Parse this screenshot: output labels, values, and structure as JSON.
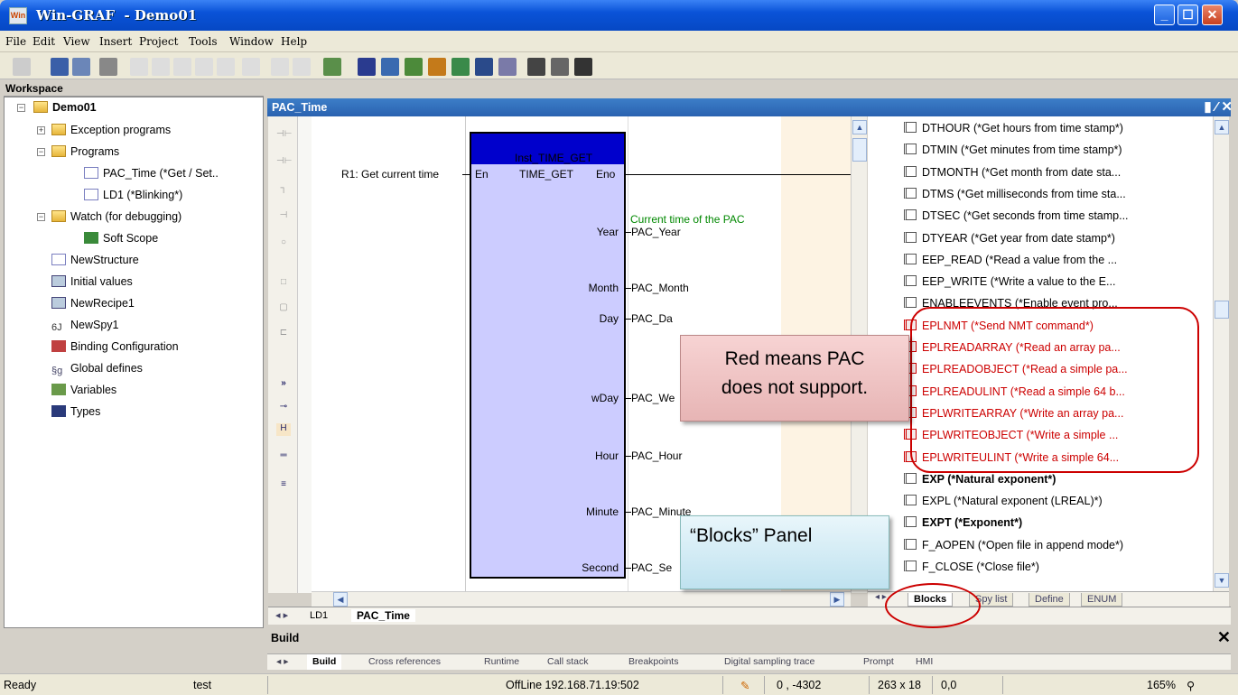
{
  "window": {
    "app": "Win-GRAF",
    "doc": "- Demo01",
    "icon_text": "Win"
  },
  "menu": [
    "File",
    "Edit",
    "View",
    "Insert",
    "Project",
    "Tools",
    "Window",
    "Help"
  ],
  "workspace": {
    "title": "Workspace",
    "root": "Demo01",
    "nodes": [
      "Exception programs",
      "Programs",
      "PAC_Time (*Get / Set..",
      "LD1 (*Blinking*)",
      "Watch (for debugging)",
      "Soft Scope",
      "NewStructure",
      "Initial values",
      "NewRecipe1",
      "NewSpy1",
      "Binding Configuration",
      "Global defines",
      "Variables",
      "Types"
    ]
  },
  "editor": {
    "title": "PAC_Time",
    "rung_label": "R1: Get current time",
    "block": {
      "instance": "Inst_TIME_GET",
      "type": "TIME_GET",
      "in": "En",
      "out": "Eno"
    },
    "comment": "Current time of the PAC",
    "outputs": [
      {
        "pin": "Year",
        "var": "PAC_Year"
      },
      {
        "pin": "Month",
        "var": "PAC_Month"
      },
      {
        "pin": "Day",
        "var": "PAC_Da"
      },
      {
        "pin": "wDay",
        "var": "PAC_We"
      },
      {
        "pin": "Hour",
        "var": "PAC_Hour"
      },
      {
        "pin": "Minute",
        "var": "PAC_Minute"
      },
      {
        "pin": "Second",
        "var": "PAC_Se"
      }
    ],
    "tabs": [
      "LD1",
      "PAC_Time"
    ]
  },
  "blocks": {
    "items": [
      {
        "t": "DTHOUR (*Get hours from time stamp*)",
        "red": false
      },
      {
        "t": "DTMIN (*Get minutes from time stamp*)",
        "red": false
      },
      {
        "t": "DTMONTH (*Get month from date sta...",
        "red": false
      },
      {
        "t": "DTMS (*Get milliseconds from time sta...",
        "red": false
      },
      {
        "t": "DTSEC (*Get seconds from time stamp...",
        "red": false
      },
      {
        "t": "DTYEAR (*Get year from date stamp*)",
        "red": false
      },
      {
        "t": "EEP_READ (*Read a value from the ...",
        "red": false
      },
      {
        "t": "EEP_WRITE (*Write a value to the E...",
        "red": false
      },
      {
        "t": "ENABLEEVENTS (*Enable event pro...",
        "red": false
      },
      {
        "t": "EPLNMT (*Send NMT command*)",
        "red": true
      },
      {
        "t": "EPLREADARRAY (*Read an array pa...",
        "red": true
      },
      {
        "t": "EPLREADOBJECT (*Read a simple pa...",
        "red": true
      },
      {
        "t": "EPLREADULINT (*Read a simple 64 b...",
        "red": true
      },
      {
        "t": "EPLWRITEARRAY (*Write an array pa...",
        "red": true
      },
      {
        "t": "EPLWRITEOBJECT (*Write a simple ...",
        "red": true
      },
      {
        "t": "EPLWRITEULINT (*Write a simple 64...",
        "red": true
      },
      {
        "t": "EXP (*Natural exponent*)",
        "red": false,
        "bold": true
      },
      {
        "t": "EXPL (*Natural exponent (LREAL)*)",
        "red": false
      },
      {
        "t": "EXPT (*Exponent*)",
        "red": false,
        "bold": true
      },
      {
        "t": "F_AOPEN (*Open file in append mode*)",
        "red": false
      },
      {
        "t": "F_CLOSE (*Close file*)",
        "red": false
      }
    ],
    "tabs": [
      "Blocks",
      "Spy list",
      "Define",
      "ENUM"
    ]
  },
  "build": {
    "title": "Build",
    "tabs": [
      "Build",
      "Cross references",
      "Runtime",
      "Call stack",
      "Breakpoints",
      "Digital sampling trace",
      "Prompt",
      "HMI"
    ]
  },
  "status": {
    "ready": "Ready",
    "project": "test",
    "conn": "OffLine 192.168.71.19:502",
    "coord": "0 , -4302",
    "size": "263 x 18",
    "pos": "0,0",
    "zoom": "165%"
  },
  "callouts": {
    "red_line1": "Red means PAC",
    "red_line2": "does not support.",
    "blue": "“Blocks” Panel"
  },
  "colors": {
    "unsupported": "#cc0000",
    "block_fill": "#ccccff",
    "block_header": "#0000cc"
  }
}
